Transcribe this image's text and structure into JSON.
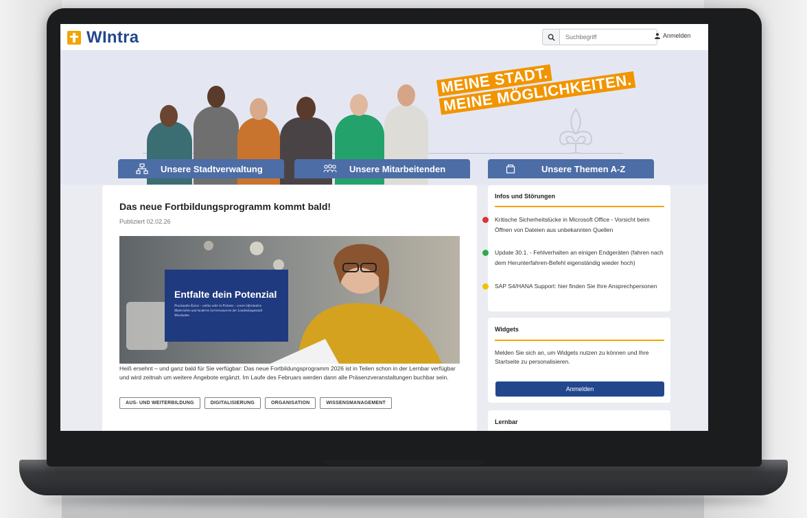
{
  "header": {
    "logo_text": "WIntra",
    "search_placeholder": "Suchbegriff",
    "login_label": "Anmelden"
  },
  "hero": {
    "slogan": [
      "MEINE STADT.",
      "MEINE MÖGLICHKEITEN."
    ]
  },
  "nav": {
    "items": [
      {
        "label": "Unsere Stadtverwaltung",
        "icon": "org-chart-icon"
      },
      {
        "label": "Unsere Mitarbeitenden",
        "icon": "people-icon"
      },
      {
        "label": "Unsere Themen A-Z",
        "icon": "folder-icon"
      }
    ]
  },
  "article": {
    "title": "Das neue Fortbildungsprogramm kommt bald!",
    "published": "Publiziert 02.02.26",
    "image_promo_title": "Entfalte dein Potenzial",
    "image_promo_text": "Praxisnahe Kurse – online oder in Präsenz – sowie informative Materialien und moderne Lernressourcen der Landeshauptstadt Wiesbaden.",
    "body": "Heiß ersehnt – und ganz bald für Sie verfügbar: Das neue Fortbildungsprogramm 2026 ist in Teilen schon in der Lernbar verfügbar und wird zeitnah um weitere Angebote ergänzt. Im Laufe des Februars werden dann alle Präsenzveranstaltungen buchbar sein.",
    "tags": [
      "AUS- UND WEITERBILDUNG",
      "DIGITALISIERUNG",
      "ORGANISATION",
      "WISSENSMANAGEMENT"
    ]
  },
  "sidebar": {
    "infos": {
      "title": "Infos und Störungen",
      "items": [
        {
          "text": "Kritische Sicherheitslücke in Microsoft Office - Vorsicht beim Öffnen von Dateien aus unbekannten Quellen",
          "status": "critical",
          "color": "#d9343a"
        },
        {
          "text": "Update 30.1. - Fehlverhalten an einigen Endgeräten (fahren nach dem Herunterfahren-Befehl eigenständig wieder hoch)",
          "status": "resolved",
          "color": "#2fa84f"
        },
        {
          "text": "SAP S4/HANA Support: hier finden Sie Ihre Ansprechpersonen",
          "status": "info",
          "color": "#f2c200"
        }
      ]
    },
    "widgets": {
      "title": "Widgets",
      "text": "Melden Sie sich an, um Widgets nutzen zu können und Ihre Startseite zu personalisieren.",
      "button": "Anmelden"
    },
    "lernbar": {
      "title": "Lernbar"
    }
  },
  "colors": {
    "brand_blue": "#23478d",
    "nav_blue": "#4c6da6",
    "accent_orange": "#f2a400",
    "slogan_orange": "#f29400"
  }
}
